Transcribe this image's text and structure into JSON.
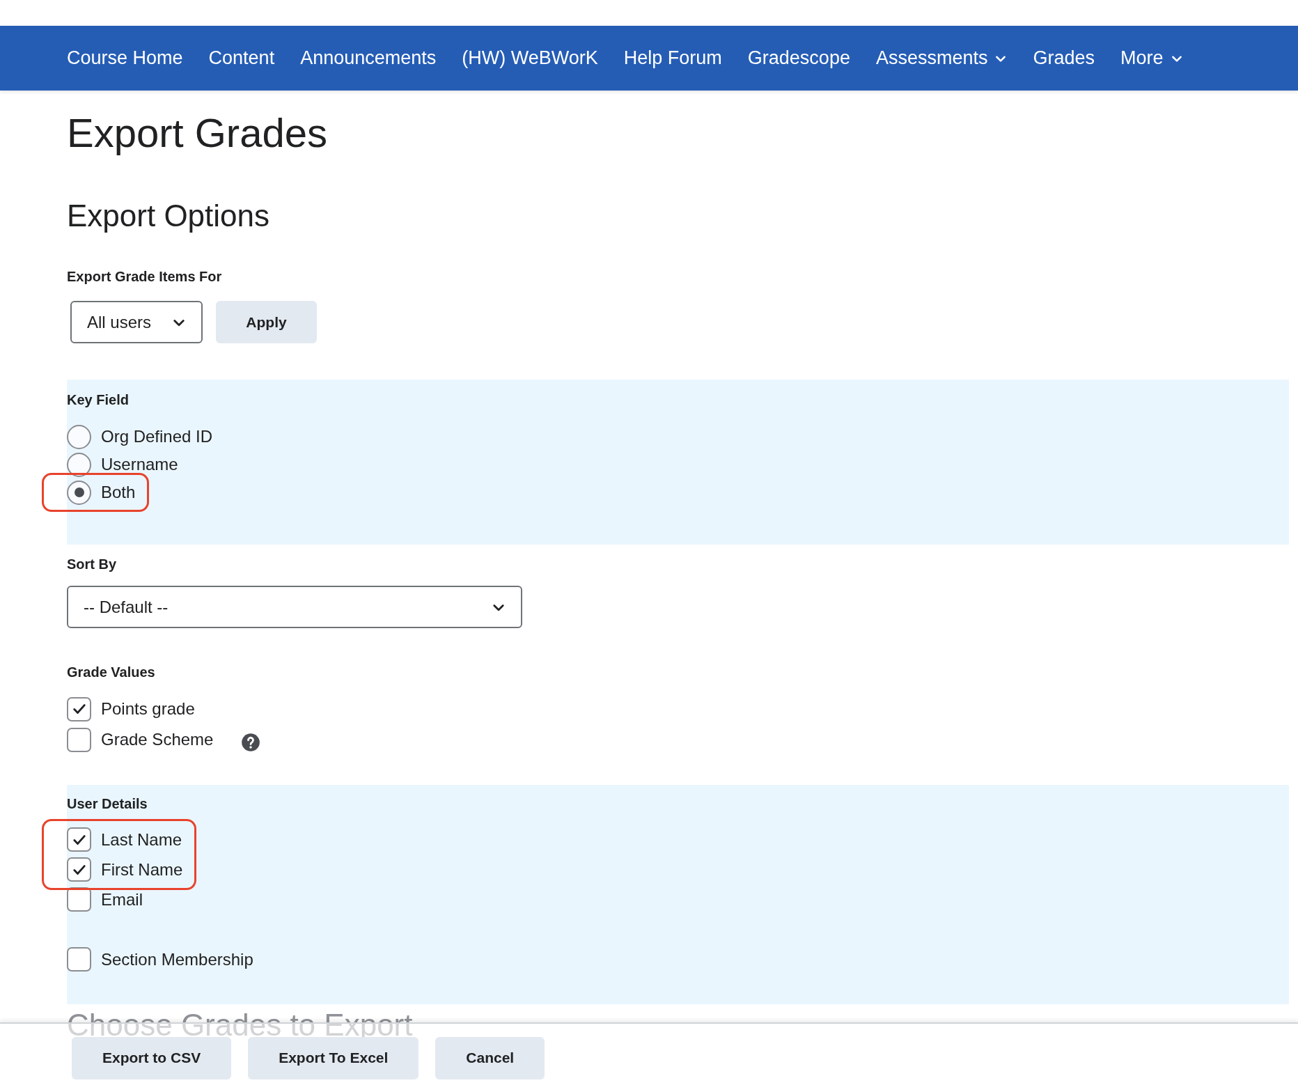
{
  "nav": {
    "items": [
      {
        "label": "Course Home",
        "has_menu": false
      },
      {
        "label": "Content",
        "has_menu": false
      },
      {
        "label": "Announcements",
        "has_menu": false
      },
      {
        "label": "(HW) WeBWorK",
        "has_menu": false
      },
      {
        "label": "Help Forum",
        "has_menu": false
      },
      {
        "label": "Gradescope",
        "has_menu": false
      },
      {
        "label": "Assessments",
        "has_menu": true
      },
      {
        "label": "Grades",
        "has_menu": false
      },
      {
        "label": "More",
        "has_menu": true
      }
    ]
  },
  "page_title": "Export Grades",
  "section_title": "Export Options",
  "export_for": {
    "label": "Export Grade Items For",
    "value": "All users",
    "button": "Apply"
  },
  "key_field": {
    "label": "Key Field",
    "options": [
      {
        "label": "Org Defined ID",
        "selected": false,
        "highlighted": false
      },
      {
        "label": "Username",
        "selected": false,
        "highlighted": false
      },
      {
        "label": "Both",
        "selected": true,
        "highlighted": true
      }
    ]
  },
  "sort_by": {
    "label": "Sort By",
    "value": "-- Default --"
  },
  "grade_values": {
    "label": "Grade Values",
    "items": [
      {
        "label": "Points grade",
        "checked": true,
        "help": false
      },
      {
        "label": "Grade Scheme",
        "checked": false,
        "help": true
      }
    ]
  },
  "user_details": {
    "label": "User Details",
    "groups": [
      {
        "items": [
          {
            "label": "Last Name",
            "checked": true,
            "highlighted": true
          },
          {
            "label": "First Name",
            "checked": true,
            "highlighted": true
          },
          {
            "label": "Email",
            "checked": false,
            "highlighted": false
          }
        ]
      },
      {
        "items": [
          {
            "label": "Section Membership",
            "checked": false,
            "highlighted": false
          }
        ]
      }
    ]
  },
  "next_section_title": "Choose Grades to Export",
  "footer_buttons": [
    "Export to CSV",
    "Export To Excel",
    "Cancel"
  ]
}
